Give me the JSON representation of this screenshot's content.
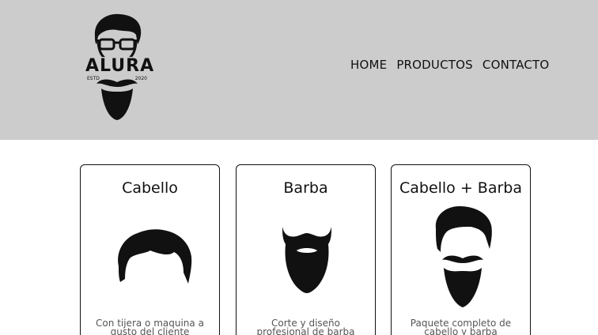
{
  "logo": {
    "word": "ALURA",
    "estd": "ESTD",
    "year": "2020"
  },
  "nav": {
    "items": [
      "HOME",
      "PRODUCTOS",
      "CONTACTO"
    ]
  },
  "cards": [
    {
      "title": "Cabello",
      "description": "Con tijera o maquina a gusto del cliente",
      "icon": "hair-icon"
    },
    {
      "title": "Barba",
      "description": "Corte y diseño profesional de barba",
      "icon": "beard-icon"
    },
    {
      "title": "Cabello + Barba",
      "description": "Paquete completo de cabello y barba",
      "icon": "hair-beard-icon"
    }
  ],
  "colors": {
    "header_bg": "#cccccc",
    "text": "#111111",
    "desc_text": "#555555"
  }
}
